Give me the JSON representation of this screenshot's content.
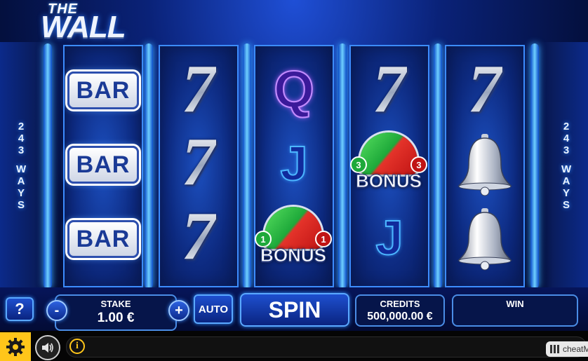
{
  "game": {
    "logo_top": "THE",
    "logo_main": "WALL",
    "ways_number": "243",
    "ways_label": "WAYS"
  },
  "reels": [
    [
      "BAR",
      "BAR",
      "BAR"
    ],
    [
      "7",
      "7",
      "7"
    ],
    [
      "Q",
      "J",
      "BONUS"
    ],
    [
      "7",
      "BONUS",
      "J"
    ],
    [
      "7",
      "bell",
      "bell"
    ]
  ],
  "bonus_symbols": [
    {
      "text": "BONUS",
      "left_badge": "1",
      "right_badge": "1"
    },
    {
      "text": "BONUS",
      "left_badge": "3",
      "right_badge": "3"
    }
  ],
  "controls": {
    "help": "?",
    "minus": "-",
    "plus": "+",
    "stake_label": "STAKE",
    "stake_value": "1.00 €",
    "auto": "AUTO",
    "spin": "SPIN",
    "credits_label": "CREDITS",
    "credits_value": "500,000.00 €",
    "win_label": "WIN",
    "win_value": ""
  },
  "status": {
    "info": "i",
    "cheat_label": "cheatM"
  },
  "icons": [
    "gear-icon",
    "speaker-icon",
    "info-icon",
    "menu-grid-icon"
  ],
  "colors": {
    "accent": "#2f8cff",
    "gear_bg": "#ffc61a",
    "bonus_green": "#1ea93a",
    "bonus_red": "#c01414"
  }
}
